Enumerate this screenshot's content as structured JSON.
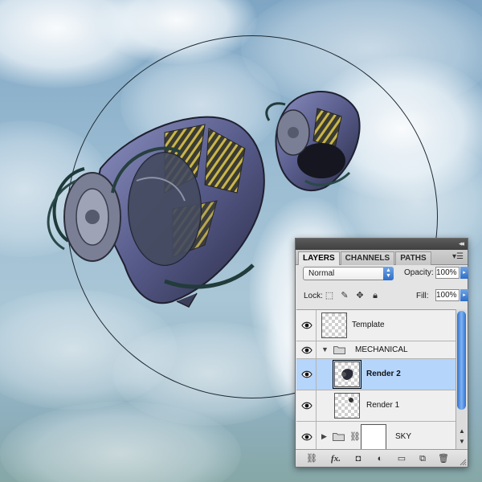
{
  "panel": {
    "tabs": [
      {
        "label": "LAYERS",
        "active": true
      },
      {
        "label": "CHANNELS",
        "active": false
      },
      {
        "label": "PATHS",
        "active": false
      }
    ],
    "blend_mode": "Normal",
    "opacity_label": "Opacity:",
    "opacity_value": "100%",
    "lock_label": "Lock:",
    "fill_label": "Fill:",
    "fill_value": "100%",
    "layers": [
      {
        "name": "Template",
        "type": "layer",
        "visible": true,
        "selected": false
      },
      {
        "name": "MECHANICAL",
        "type": "group",
        "expanded": true,
        "visible": true
      },
      {
        "name": "Render 2",
        "type": "layer",
        "visible": true,
        "selected": true
      },
      {
        "name": "Render 1",
        "type": "layer",
        "visible": true,
        "selected": false
      },
      {
        "name": "SKY",
        "type": "group",
        "expanded": false,
        "visible": true,
        "has_mask": true
      }
    ],
    "footer_icons": [
      "link-icon",
      "fx-icon",
      "mask-icon",
      "adjustment-icon",
      "folder-icon",
      "new-layer-icon",
      "trash-icon"
    ],
    "selection_color": "#b5d5fb",
    "scrollbar_color": "#4a86dc"
  }
}
